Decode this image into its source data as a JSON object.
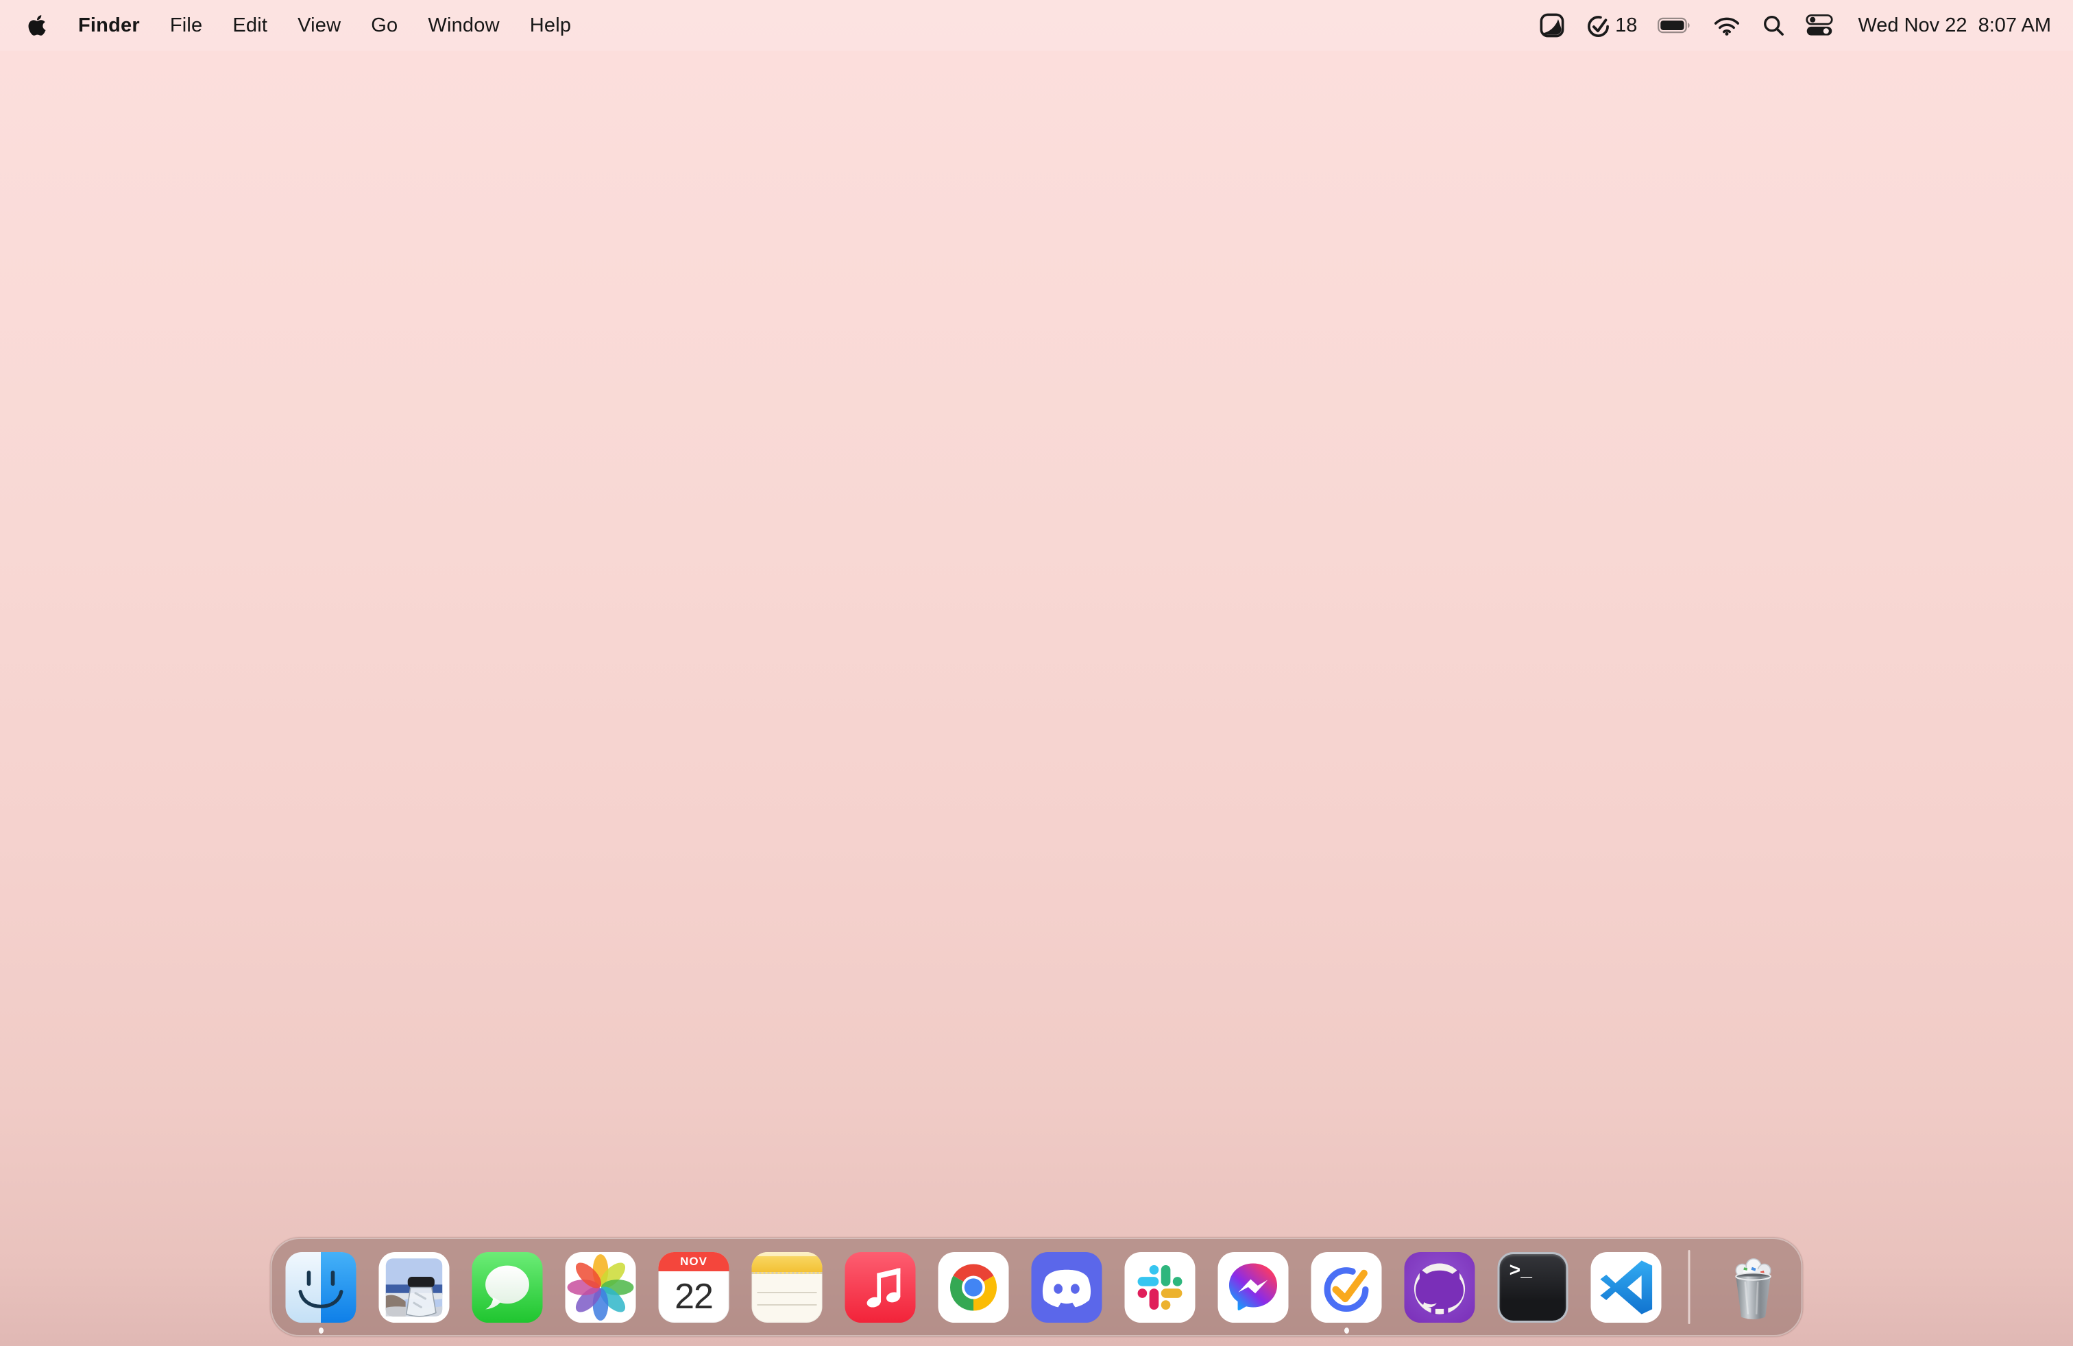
{
  "wallpaper": {
    "top_color": "#fcdfdd",
    "bottom_color": "#e0b8b4"
  },
  "menu_bar": {
    "apple_icon": "apple-logo",
    "items": [
      "Finder",
      "File",
      "Edit",
      "View",
      "Go",
      "Window",
      "Help"
    ],
    "status_icons": [
      "cleanshot-icon",
      "ticktick-check-icon",
      "battery-icon",
      "wifi-icon",
      "spotlight-search-icon",
      "control-center-icon"
    ],
    "ticktick_badge": "18",
    "clock": "Wed Nov 22  8:07 AM"
  },
  "dock": {
    "apps": [
      {
        "name": "Finder",
        "icon": "finder-icon",
        "running": true
      },
      {
        "name": "Preview",
        "icon": "preview-icon",
        "running": false
      },
      {
        "name": "Messages",
        "icon": "messages-icon",
        "running": false
      },
      {
        "name": "Photos",
        "icon": "photos-icon",
        "running": false
      },
      {
        "name": "Calendar",
        "icon": "calendar-icon",
        "running": false,
        "month": "NOV",
        "day": "22"
      },
      {
        "name": "Notes",
        "icon": "notes-icon",
        "running": false
      },
      {
        "name": "Music",
        "icon": "music-icon",
        "running": false
      },
      {
        "name": "Google Chrome",
        "icon": "chrome-icon",
        "running": false
      },
      {
        "name": "Discord",
        "icon": "discord-icon",
        "running": false
      },
      {
        "name": "Slack",
        "icon": "slack-icon",
        "running": false
      },
      {
        "name": "Messenger",
        "icon": "messenger-icon",
        "running": false
      },
      {
        "name": "TickTick",
        "icon": "ticktick-icon",
        "running": true
      },
      {
        "name": "GitHub Desktop",
        "icon": "github-icon",
        "running": false
      },
      {
        "name": "Terminal",
        "icon": "terminal-icon",
        "running": false,
        "prompt": ">_"
      },
      {
        "name": "Visual Studio Code",
        "icon": "vscode-icon",
        "running": false
      }
    ],
    "trash": {
      "name": "Trash",
      "state": "full"
    }
  }
}
